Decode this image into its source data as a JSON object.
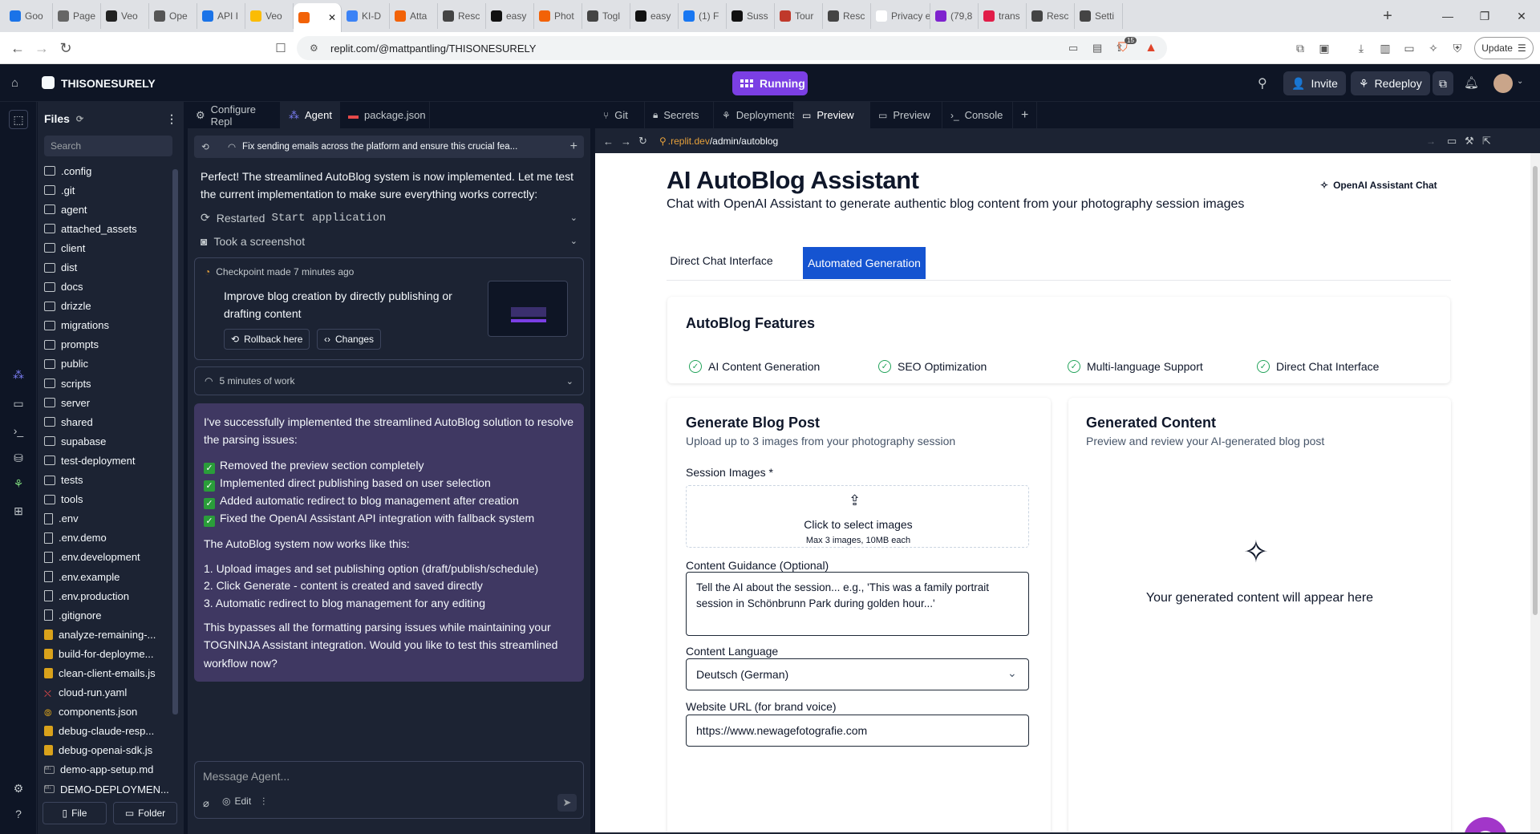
{
  "browser": {
    "tabs": [
      {
        "label": "Goo",
        "color": "#1a73e8"
      },
      {
        "label": "Page",
        "color": "#666"
      },
      {
        "label": "Veo",
        "color": "#222"
      },
      {
        "label": "Ope",
        "color": "#555"
      },
      {
        "label": "API I",
        "color": "#1a73e8"
      },
      {
        "label": "Veo",
        "color": "#fbbc04"
      },
      {
        "label": "",
        "color": "#f26207",
        "active": true
      },
      {
        "label": "KI-D",
        "color": "#3b82f6"
      },
      {
        "label": "Atta",
        "color": "#f26207"
      },
      {
        "label": "Resc",
        "color": "#444"
      },
      {
        "label": "easy",
        "color": "#111"
      },
      {
        "label": "Phot",
        "color": "#f26207"
      },
      {
        "label": "Togl",
        "color": "#444"
      },
      {
        "label": "easy",
        "color": "#111"
      },
      {
        "label": "(1) F",
        "color": "#1877f2"
      },
      {
        "label": "Suss",
        "color": "#111"
      },
      {
        "label": "Tour",
        "color": "#c0392b"
      },
      {
        "label": "Resc",
        "color": "#444"
      },
      {
        "label": "Privacy e",
        "color": "#fff"
      },
      {
        "label": "(79,8",
        "color": "#7e22ce"
      },
      {
        "label": "trans",
        "color": "#e11d48"
      },
      {
        "label": "Resc",
        "color": "#444"
      },
      {
        "label": "Setti",
        "color": "#444"
      }
    ],
    "url": "replit.com/@mattpantling/THISONESURELY",
    "update_label": "Update",
    "brave_count": "15"
  },
  "replit": {
    "repl_name": "THISONESURELY",
    "running_label": "Running",
    "invite_label": "Invite",
    "redeploy_label": "Redeploy"
  },
  "files": {
    "title": "Files",
    "search_placeholder": "Search",
    "items": [
      {
        "name": ".config",
        "type": "folder"
      },
      {
        "name": ".git",
        "type": "folder"
      },
      {
        "name": "agent",
        "type": "folder"
      },
      {
        "name": "attached_assets",
        "type": "folder"
      },
      {
        "name": "client",
        "type": "folder"
      },
      {
        "name": "dist",
        "type": "folder"
      },
      {
        "name": "docs",
        "type": "folder"
      },
      {
        "name": "drizzle",
        "type": "folder"
      },
      {
        "name": "migrations",
        "type": "folder"
      },
      {
        "name": "prompts",
        "type": "folder"
      },
      {
        "name": "public",
        "type": "folder"
      },
      {
        "name": "scripts",
        "type": "folder"
      },
      {
        "name": "server",
        "type": "folder"
      },
      {
        "name": "shared",
        "type": "folder"
      },
      {
        "name": "supabase",
        "type": "folder"
      },
      {
        "name": "test-deployment",
        "type": "folder"
      },
      {
        "name": "tests",
        "type": "folder"
      },
      {
        "name": "tools",
        "type": "folder"
      },
      {
        "name": ".env",
        "type": "file"
      },
      {
        "name": ".env.demo",
        "type": "file"
      },
      {
        "name": ".env.development",
        "type": "file"
      },
      {
        "name": ".env.example",
        "type": "file"
      },
      {
        "name": ".env.production",
        "type": "file"
      },
      {
        "name": ".gitignore",
        "type": "file"
      },
      {
        "name": "analyze-remaining-...",
        "type": "js"
      },
      {
        "name": "build-for-deployme...",
        "type": "js"
      },
      {
        "name": "clean-client-emails.js",
        "type": "js"
      },
      {
        "name": "cloud-run.yaml",
        "type": "yml"
      },
      {
        "name": "components.json",
        "type": "json"
      },
      {
        "name": "debug-claude-resp...",
        "type": "js"
      },
      {
        "name": "debug-openai-sdk.js",
        "type": "js"
      },
      {
        "name": "demo-app-setup.md",
        "type": "md"
      },
      {
        "name": "DEMO-DEPLOYMEN...",
        "type": "md"
      }
    ],
    "new_file_label": "File",
    "new_folder_label": "Folder"
  },
  "agent_tabs": [
    {
      "label": "Configure Repl"
    },
    {
      "label": "Agent",
      "active": true
    },
    {
      "label": "package.json"
    }
  ],
  "agent": {
    "task_title": "Fix sending emails across the platform and ensure this crucial fea...",
    "intro": "Perfect! The streamlined AutoBlog system is now implemented. Let me test the current implementation to make sure everything works correctly:",
    "action1_prefix": "Restarted",
    "action1_code": "Start application",
    "action2": "Took a screenshot",
    "checkpoint_meta": "Checkpoint made 7 minutes ago",
    "checkpoint_title": "Improve blog creation by directly publishing or drafting content",
    "rollback_label": "Rollback here",
    "changes_label": "Changes",
    "work_label": "5 minutes of work",
    "summary_intro": "I've successfully implemented the streamlined AutoBlog solution to resolve the parsing issues:",
    "checks": [
      "Removed the preview section completely",
      "Implemented direct publishing based on user selection",
      "Added automatic redirect to blog management after creation",
      "Fixed the OpenAI Assistant API integration with fallback system"
    ],
    "works_heading": "The AutoBlog system now works like this:",
    "steps": [
      "1. Upload images and set publishing option (draft/publish/schedule)",
      "2. Click Generate - content is created and saved directly",
      "3. Automatic redirect to blog management for any editing"
    ],
    "closing": "This bypasses all the formatting parsing issues while maintaining your TOGNINJA Assistant integration. Would you like to test this streamlined workflow now?",
    "input_placeholder": "Message Agent...",
    "edit_label": "Edit"
  },
  "right_tabs": [
    {
      "label": "Git"
    },
    {
      "label": "Secrets"
    },
    {
      "label": "Deployments"
    },
    {
      "label": "Preview",
      "active": true
    },
    {
      "label": "Preview"
    },
    {
      "label": "Console"
    }
  ],
  "preview": {
    "url_prefix": ".replit.dev",
    "url_path": "/admin/autoblog"
  },
  "app": {
    "title": "AI AutoBlog Assistant",
    "subtitle": "Chat with OpenAI Assistant to generate authentic blog content from your photography session images",
    "assistant_chat_label": "OpenAI Assistant Chat",
    "tab_direct": "Direct Chat Interface",
    "tab_auto": "Automated Generation",
    "features_title": "AutoBlog Features",
    "features": [
      "AI Content Generation",
      "SEO Optimization",
      "Multi-language Support",
      "Direct Chat Interface"
    ],
    "gen_title": "Generate Blog Post",
    "gen_subtitle": "Upload up to 3 images from your photography session",
    "images_label": "Session Images *",
    "upload_label": "Click to select images",
    "upload_hint": "Max 3 images, 10MB each",
    "guidance_label": "Content Guidance (Optional)",
    "guidance_placeholder": "Tell the AI about the session... e.g., 'This was a family portrait session in Schönbrunn Park during golden hour...'",
    "language_label": "Content Language",
    "language_value": "Deutsch (German)",
    "website_label": "Website URL (for brand voice)",
    "website_value": "https://www.newagefotografie.com",
    "out_title": "Generated Content",
    "out_subtitle": "Preview and review your AI-generated blog post",
    "out_empty": "Your generated content will appear here",
    "accent": "#1554d1"
  }
}
